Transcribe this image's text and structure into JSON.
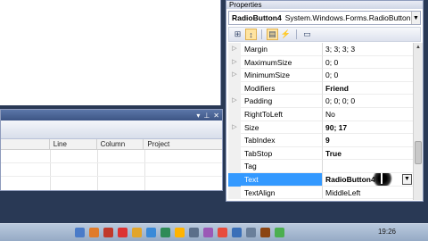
{
  "properties": {
    "title": "Properties",
    "object": {
      "name": "RadioButton4",
      "type": "System.Windows.Forms.RadioButton"
    },
    "rows": [
      {
        "name": "Margin",
        "value": "3; 3; 3; 3",
        "expandable": true,
        "bold": false
      },
      {
        "name": "MaximumSize",
        "value": "0; 0",
        "expandable": true,
        "bold": false
      },
      {
        "name": "MinimumSize",
        "value": "0; 0",
        "expandable": true,
        "bold": false
      },
      {
        "name": "Modifiers",
        "value": "Friend",
        "expandable": false,
        "bold": true
      },
      {
        "name": "Padding",
        "value": "0; 0; 0; 0",
        "expandable": true,
        "bold": false
      },
      {
        "name": "RightToLeft",
        "value": "No",
        "expandable": false,
        "bold": false
      },
      {
        "name": "Size",
        "value": "90; 17",
        "expandable": true,
        "bold": true
      },
      {
        "name": "TabIndex",
        "value": "9",
        "expandable": false,
        "bold": true
      },
      {
        "name": "TabStop",
        "value": "True",
        "expandable": false,
        "bold": true
      },
      {
        "name": "Tag",
        "value": "",
        "expandable": false,
        "bold": false
      },
      {
        "name": "Text",
        "value": "RadioButton4",
        "expandable": false,
        "bold": true
      },
      {
        "name": "TextAlign",
        "value": "MiddleLeft",
        "expandable": false,
        "bold": false
      }
    ],
    "selected_row": "Text"
  },
  "error_list": {
    "columns": [
      "",
      "Line",
      "Column",
      "Project"
    ]
  },
  "taskbar": {
    "time": "19:26",
    "icon_colors": [
      "#4a7bc8",
      "#e07b2a",
      "#c0392b",
      "#d33",
      "#e2a52b",
      "#3a8ad8",
      "#2e8b57",
      "#ffb300",
      "#5b6f8a",
      "#9b59b6",
      "#e74c3c",
      "#3a6fb8",
      "#6a7f9a",
      "#8b4513",
      "#4caf50"
    ]
  },
  "colors": {
    "selection": "#3399ff",
    "title_blue": "#3d5585"
  }
}
